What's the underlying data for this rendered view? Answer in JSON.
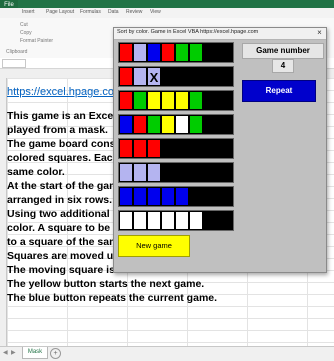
{
  "excel": {
    "file_tab": "File",
    "tabs": [
      "Insert",
      "Page Layout",
      "Formulas",
      "Data",
      "Review",
      "View"
    ],
    "ribbon_items": [
      "Cut",
      "Copy",
      "Format Painter",
      "Clipboard"
    ],
    "link": "https://excel.hpage.co",
    "text_lines": [
      "This game is an Exce",
      "played from a mask.",
      "The game board cons",
      "colored squares. Eac",
      "same color.",
      "At the start of the gam",
      "arranged in six rows.",
      "Using two additional",
      "color. A square to be",
      "to a square of the sam",
      "Squares are moved u",
      "The moving square is marked with a cross.",
      "The yellow button starts the next game.",
      "The blue button repeats the current game."
    ],
    "sheet_tab": "Mask",
    "add_sheet": "+"
  },
  "game_window": {
    "title": "Sort by color. Game in Excel VBA    https://excel.hpage.com",
    "close_label": "×",
    "game_number_label": "Game number",
    "game_number_value": "4",
    "repeat_label": "Repeat",
    "new_game_label": "New game",
    "cross_mark": "X",
    "rows": [
      [
        "red",
        "lavender",
        "blue",
        "red",
        "green",
        "green",
        "empty",
        "empty"
      ],
      [
        "red",
        "lavender",
        "cross",
        "empty",
        "empty",
        "empty",
        "empty",
        "empty"
      ],
      [
        "red",
        "green",
        "yellow",
        "yellow",
        "yellow",
        "green",
        "empty",
        "empty"
      ],
      [
        "blue",
        "red",
        "green",
        "yellow",
        "white",
        "green",
        "empty",
        "empty"
      ],
      [
        "red",
        "red",
        "red",
        "empty",
        "empty",
        "empty",
        "empty",
        "empty"
      ],
      [
        "lavender",
        "lavender",
        "lavender",
        "empty",
        "empty",
        "empty",
        "empty",
        "empty"
      ],
      [
        "blue",
        "blue",
        "blue",
        "blue",
        "blue",
        "empty",
        "empty",
        "empty"
      ],
      [
        "white",
        "white",
        "white",
        "white",
        "white",
        "white",
        "empty",
        "empty"
      ]
    ]
  },
  "colors": {
    "excel_green": "#217346",
    "red": "#ff0000",
    "green": "#00cc00",
    "blue": "#0000ee",
    "yellow": "#ffff00",
    "white": "#ffffff",
    "lavender": "#b4b4f0",
    "cross": "#b4b4f0",
    "empty": "#000000",
    "repeat_button": "#0000cc",
    "new_game_button": "#ffff00"
  }
}
